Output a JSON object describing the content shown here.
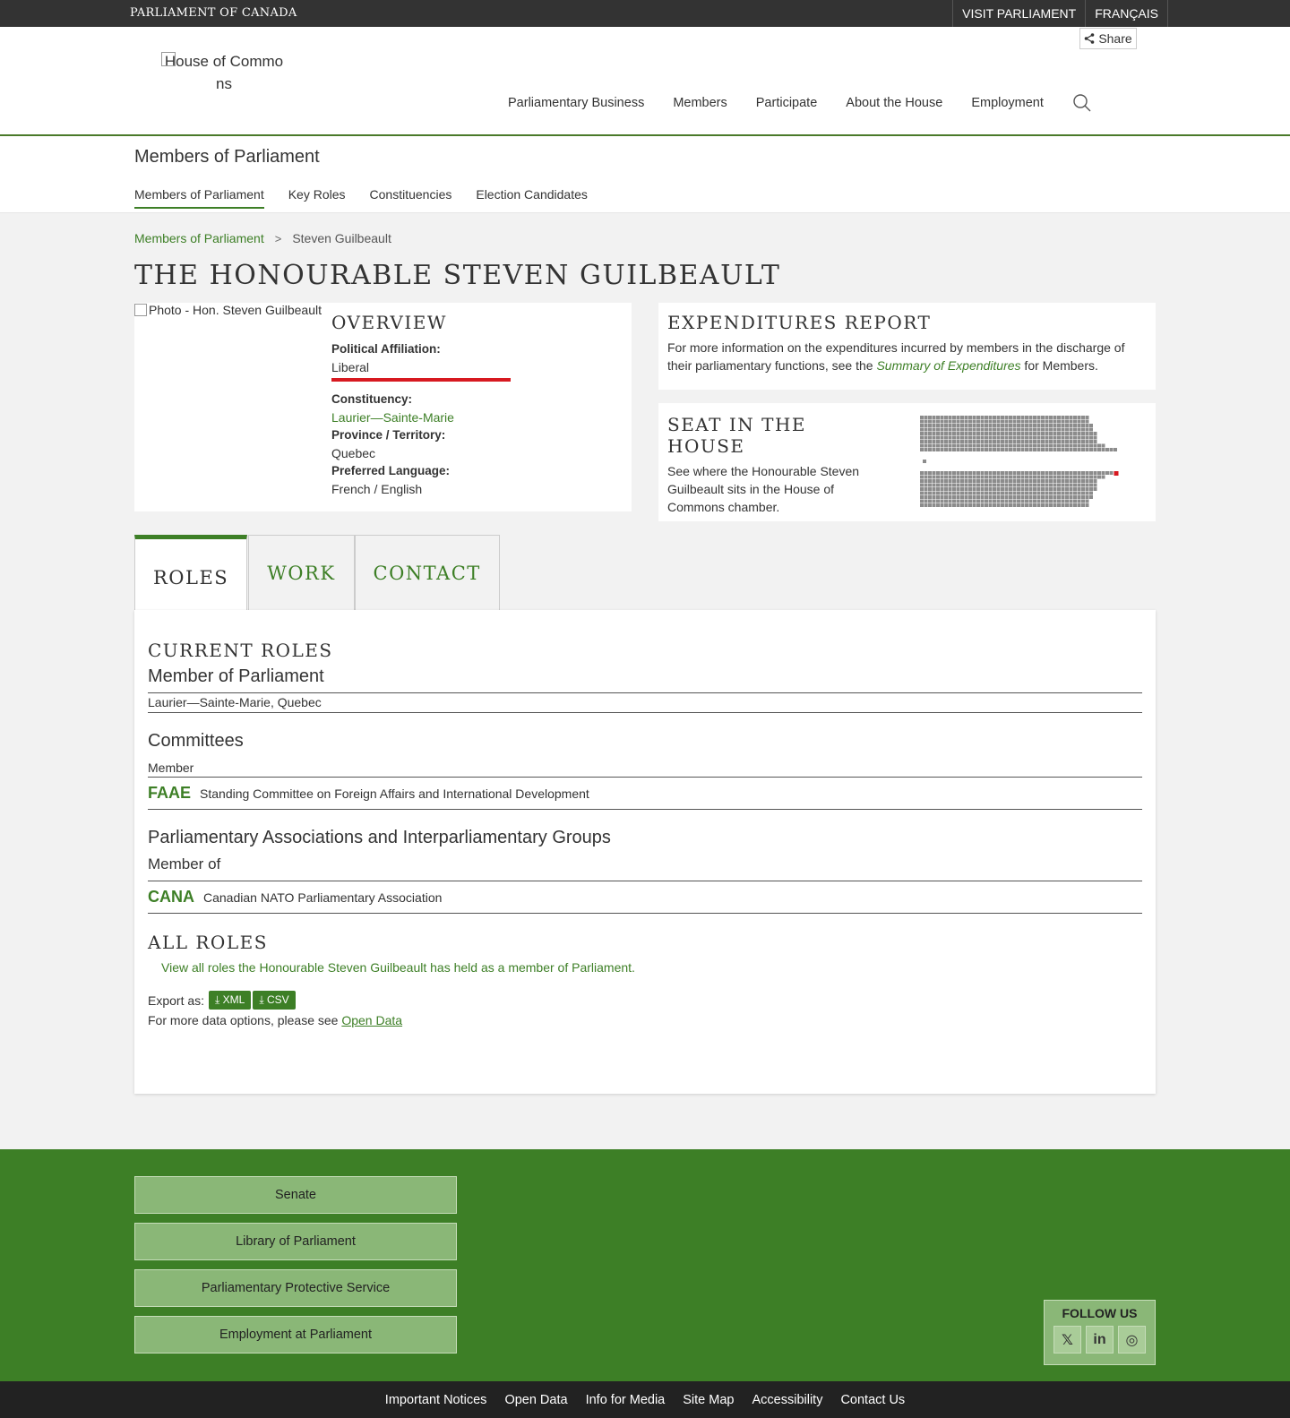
{
  "topbar": {
    "brand": "PARLIAMENT OF CANADA",
    "links": [
      "VISIT PARLIAMENT",
      "FRANÇAIS"
    ]
  },
  "header": {
    "share_label": "Share",
    "logo_alt": "House of Commons",
    "nav": [
      "Parliamentary Business",
      "Members",
      "Participate",
      "About the House",
      "Employment"
    ]
  },
  "section": {
    "title": "Members of Parliament",
    "tabs": [
      "Members of Parliament",
      "Key Roles",
      "Constituencies",
      "Election Candidates"
    ]
  },
  "breadcrumb": {
    "parent": "Members of Parliament",
    "current": "Steven Guilbeault"
  },
  "page_title": "THE HONOURABLE STEVEN GUILBEAULT",
  "overview": {
    "photo_alt": "Photo - Hon. Steven Guilbeault",
    "heading": "OVERVIEW",
    "affiliation_label": "Political Affiliation:",
    "affiliation": "Liberal",
    "party_color": "#d71920",
    "constituency_label": "Constituency:",
    "constituency": "Laurier—Sainte-Marie",
    "province_label": "Province / Territory:",
    "province": "Quebec",
    "language_label": "Preferred Language:",
    "language": "French / English"
  },
  "expenditures": {
    "heading": "EXPENDITURES REPORT",
    "text_before": "For more information on the expenditures incurred by members in the discharge of their parliamentary functions, see the ",
    "link": "Summary of Expenditures",
    "text_after": " for Members."
  },
  "seat": {
    "heading": "SEAT IN THE HOUSE",
    "text": "See where the Honourable Steven Guilbeault sits in the House of Commons chamber.",
    "seat_color": "#8c8c8c",
    "highlight_color": "#d71920"
  },
  "tabs": [
    "ROLES",
    "WORK",
    "CONTACT"
  ],
  "roles": {
    "current_heading": "CURRENT ROLES",
    "mp_title": "Member of Parliament",
    "mp_riding": "Laurier—Sainte-Marie, Quebec",
    "committees_title": "Committees",
    "committees_role": "Member",
    "committee_abbr": "FAAE",
    "committee_name": "Standing Committee on Foreign Affairs and International Development",
    "assoc_title": "Parliamentary Associations and Interparliamentary Groups",
    "assoc_role": "Member of",
    "assoc_abbr": "CANA",
    "assoc_name": "Canadian NATO Parliamentary Association",
    "all_heading": "ALL ROLES",
    "all_link": "View all roles the Honourable Steven Guilbeault has held as a member of Parliament.",
    "export_label": "Export as:",
    "export_xml": "XML",
    "export_csv": "CSV",
    "more_text": "For more data options, please see ",
    "open_data": "Open Data"
  },
  "footer": {
    "links": [
      "Senate",
      "Library of Parliament",
      "Parliamentary Protective Service",
      "Employment at Parliament"
    ],
    "follow_title": "FOLLOW US",
    "social": [
      "x-icon",
      "linkedin-icon",
      "instagram-icon"
    ],
    "social_labels": [
      "𝕏",
      "in",
      "◎"
    ]
  },
  "bottombar": [
    "Important Notices",
    "Open Data",
    "Info for Media",
    "Site Map",
    "Accessibility",
    "Contact Us"
  ],
  "colors": {
    "accent": "#3d7f26",
    "footer_button": "#8ab777"
  }
}
